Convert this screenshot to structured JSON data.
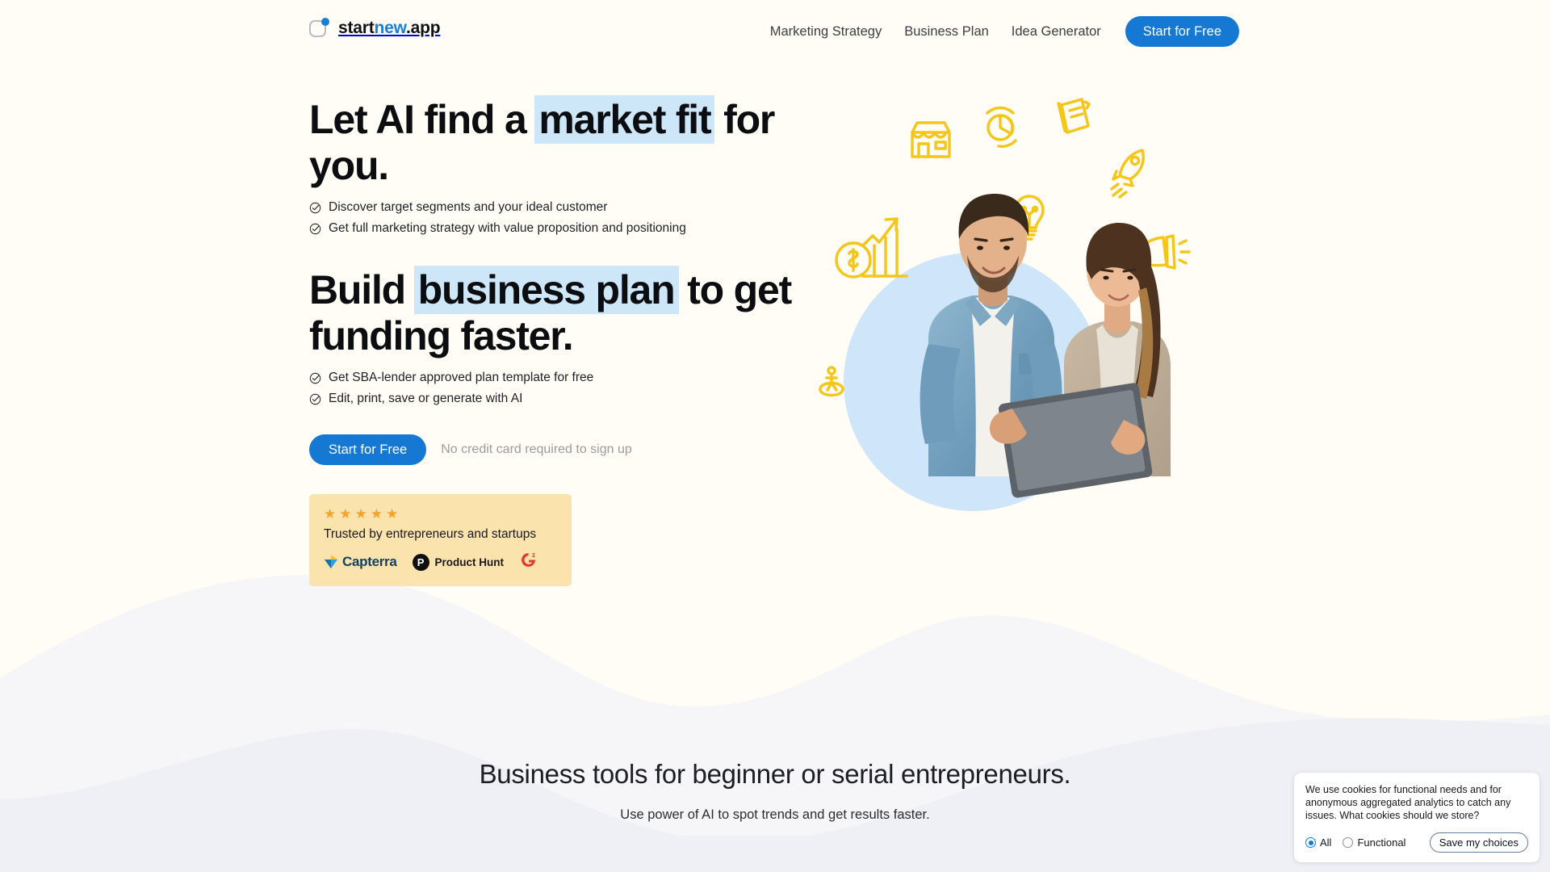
{
  "header": {
    "logo": {
      "part1": "start",
      "part2": "new",
      "part3": ".app",
      "mark_icon": "rounded-square-dot-logo"
    },
    "nav": [
      {
        "label": "Marketing Strategy"
      },
      {
        "label": "Business Plan"
      },
      {
        "label": "Idea Generator"
      }
    ],
    "cta_label": "Start for Free"
  },
  "hero": {
    "headline1": {
      "pre": "Let AI find a ",
      "highlight": "market fit",
      "post": " for you."
    },
    "bullets1": [
      "Discover target segments and your ideal customer",
      "Get full marketing strategy with value proposition and positioning"
    ],
    "headline2": {
      "pre": "Build ",
      "highlight": "business plan",
      "post": " to get funding faster."
    },
    "bullets2": [
      "Get SBA-lender approved plan template for free",
      "Edit, print, save or generate with AI"
    ],
    "cta_label": "Start for Free",
    "cta_note": "No credit card required to sign up",
    "trust": {
      "stars": 5,
      "star_glyph": "★",
      "text": "Trusted by entrepreneurs and startups",
      "logos": [
        {
          "name": "Capterra",
          "label": "Capterra"
        },
        {
          "name": "Product Hunt",
          "label": "Product Hunt",
          "mark": "P"
        },
        {
          "name": "G2",
          "label": "G2"
        }
      ]
    },
    "art": {
      "alt": "Two entrepreneurs looking at a tablet",
      "doodles": [
        "storefront-icon",
        "pie-chart-icon",
        "notebook-icon",
        "rocket-icon",
        "lightbulb-icon",
        "megaphone-icon",
        "money-growth-chart-icon",
        "person-idea-icon"
      ]
    }
  },
  "bottom": {
    "title": "Business tools for beginner or serial entrepreneurs.",
    "subtitle": "Use power of AI to spot trends and get results faster."
  },
  "cookie": {
    "message": "We use cookies for functional needs and for anonymous aggregated analytics to catch any issues. What cookies should we store?",
    "options": [
      {
        "label": "All",
        "selected": true
      },
      {
        "label": "Functional",
        "selected": false
      }
    ],
    "save_label": "Save my choices"
  },
  "colors": {
    "background": "#FFFDF5",
    "bottom_band": "#EFF0F5",
    "accent_blue": "#1578D2",
    "highlight_blue": "#CDE6F8",
    "trust_card": "#FBE3AE",
    "star": "#F2A42B",
    "doodle_yellow": "#F5C518"
  }
}
